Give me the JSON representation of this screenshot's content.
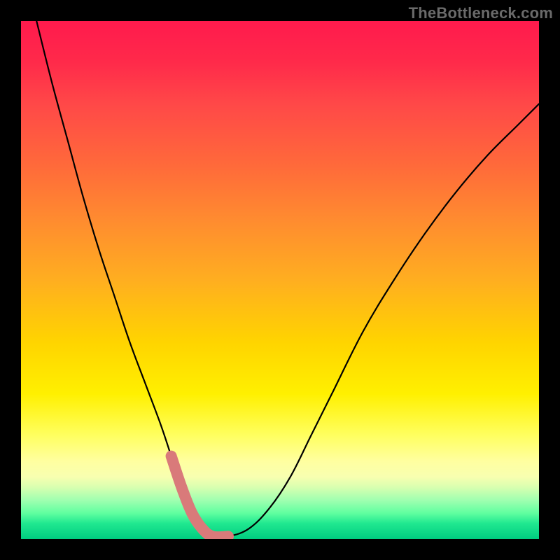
{
  "watermark": "TheBottleneck.com",
  "chart_data": {
    "type": "line",
    "title": "",
    "xlabel": "",
    "ylabel": "",
    "xlim": [
      0,
      100
    ],
    "ylim": [
      0,
      100
    ],
    "grid": false,
    "legend": false,
    "background_gradient": {
      "direction": "vertical",
      "stops": [
        {
          "pos": 0,
          "color": "#ff1a4d"
        },
        {
          "pos": 50,
          "color": "#ffae20"
        },
        {
          "pos": 80,
          "color": "#ffff60"
        },
        {
          "pos": 100,
          "color": "#00cc80"
        }
      ]
    },
    "series": [
      {
        "name": "bottleneck-curve",
        "x": [
          3,
          6,
          9,
          12,
          15,
          18,
          21,
          24,
          27,
          29,
          31,
          33,
          35,
          37,
          40,
          44,
          48,
          52,
          56,
          60,
          66,
          72,
          78,
          84,
          90,
          96,
          100
        ],
        "y": [
          100,
          88,
          77,
          66,
          56,
          47,
          38,
          30,
          22,
          16,
          10,
          5,
          2,
          0.5,
          0.5,
          2,
          6,
          12,
          20,
          28,
          40,
          50,
          59,
          67,
          74,
          80,
          84
        ]
      }
    ],
    "highlight_region": {
      "description": "optimal-zone-marker",
      "x": [
        29,
        31,
        33,
        35,
        37,
        40
      ],
      "y": [
        16,
        10,
        5,
        2,
        0.5,
        0.5
      ]
    }
  }
}
